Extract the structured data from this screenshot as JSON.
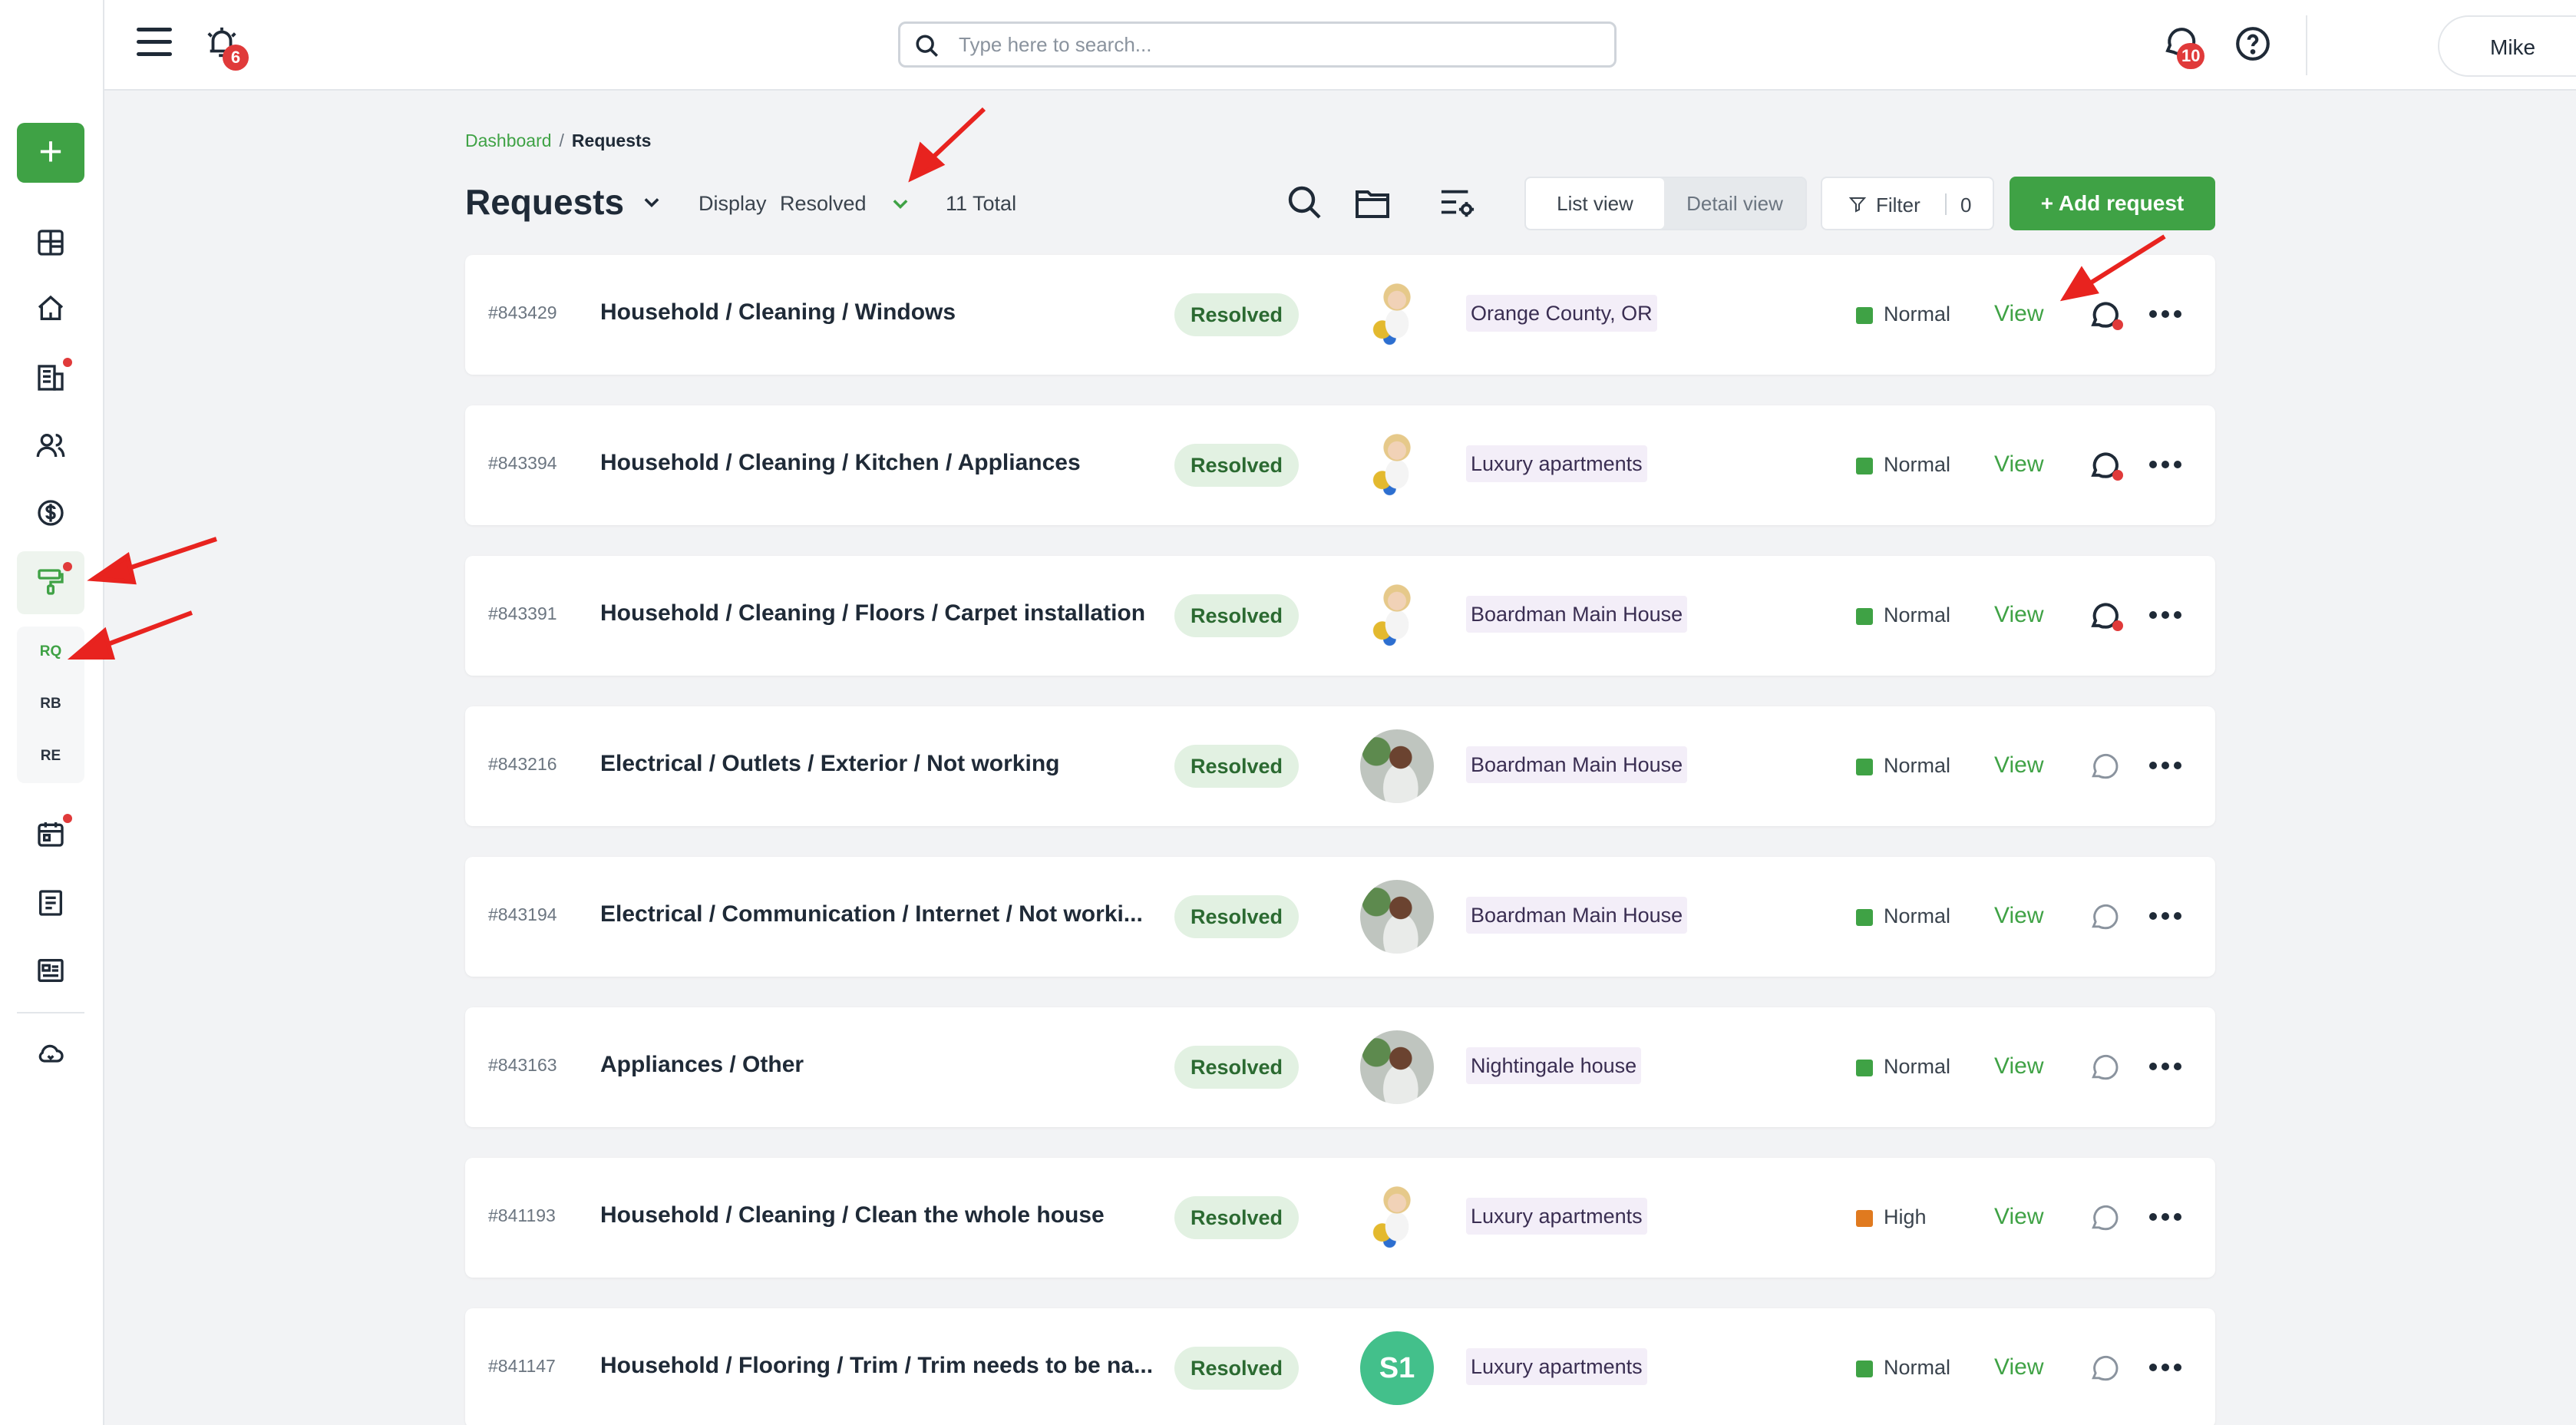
{
  "topbar": {
    "alarm_badge": "6",
    "search_placeholder": "Type here to search...",
    "chat_badge": "10",
    "user_name": "Mike"
  },
  "sidebar": {
    "sub_items": [
      "RQ",
      "RB",
      "RE"
    ]
  },
  "breadcrumb": {
    "root": "Dashboard",
    "separator": "/",
    "current": "Requests"
  },
  "header": {
    "title": "Requests",
    "display_label": "Display",
    "display_value": "Resolved",
    "total": "11 Total",
    "list_view": "List view",
    "detail_view": "Detail view",
    "filter_label": "Filter",
    "filter_count": "0",
    "add_request": "+ Add request"
  },
  "colors": {
    "accent": "#3fa245",
    "priority_normal": "#3fa245",
    "priority_high": "#e07a1f",
    "alert": "#e03a3a"
  },
  "rows": [
    {
      "id": "#843429",
      "title": "Household / Cleaning / Windows",
      "status": "Resolved",
      "avatar": "cleaner",
      "location": "Orange County, OR",
      "priority": "Normal",
      "view": "View",
      "chat_unread": true
    },
    {
      "id": "#843394",
      "title": "Household / Cleaning / Kitchen / Appliances",
      "status": "Resolved",
      "avatar": "cleaner",
      "location": "Luxury apartments",
      "priority": "Normal",
      "view": "View",
      "chat_unread": true
    },
    {
      "id": "#843391",
      "title": "Household / Cleaning / Floors / Carpet installation",
      "status": "Resolved",
      "avatar": "cleaner",
      "location": "Boardman Main House",
      "priority": "Normal",
      "view": "View",
      "chat_unread": true
    },
    {
      "id": "#843216",
      "title": "Electrical / Outlets / Exterior / Not working",
      "status": "Resolved",
      "avatar": "man",
      "location": "Boardman Main House",
      "priority": "Normal",
      "view": "View",
      "chat_unread": false,
      "recurring": true
    },
    {
      "id": "#843194",
      "title": "Electrical / Communication / Internet / Not worki...",
      "status": "Resolved",
      "avatar": "man",
      "location": "Boardman Main House",
      "priority": "Normal",
      "view": "View",
      "chat_unread": false
    },
    {
      "id": "#843163",
      "title": "Appliances / Other",
      "status": "Resolved",
      "avatar": "man",
      "location": "Nightingale house",
      "priority": "Normal",
      "view": "View",
      "chat_unread": false
    },
    {
      "id": "#841193",
      "title": "Household / Cleaning / Clean the whole house",
      "status": "Resolved",
      "avatar": "cleaner",
      "location": "Luxury apartments",
      "priority": "High",
      "view": "View",
      "chat_unread": false
    },
    {
      "id": "#841147",
      "title": "Household / Flooring / Trim / Trim needs to be na...",
      "status": "Resolved",
      "avatar": "S1",
      "location": "Luxury apartments",
      "priority": "Normal",
      "view": "View",
      "chat_unread": false
    }
  ]
}
